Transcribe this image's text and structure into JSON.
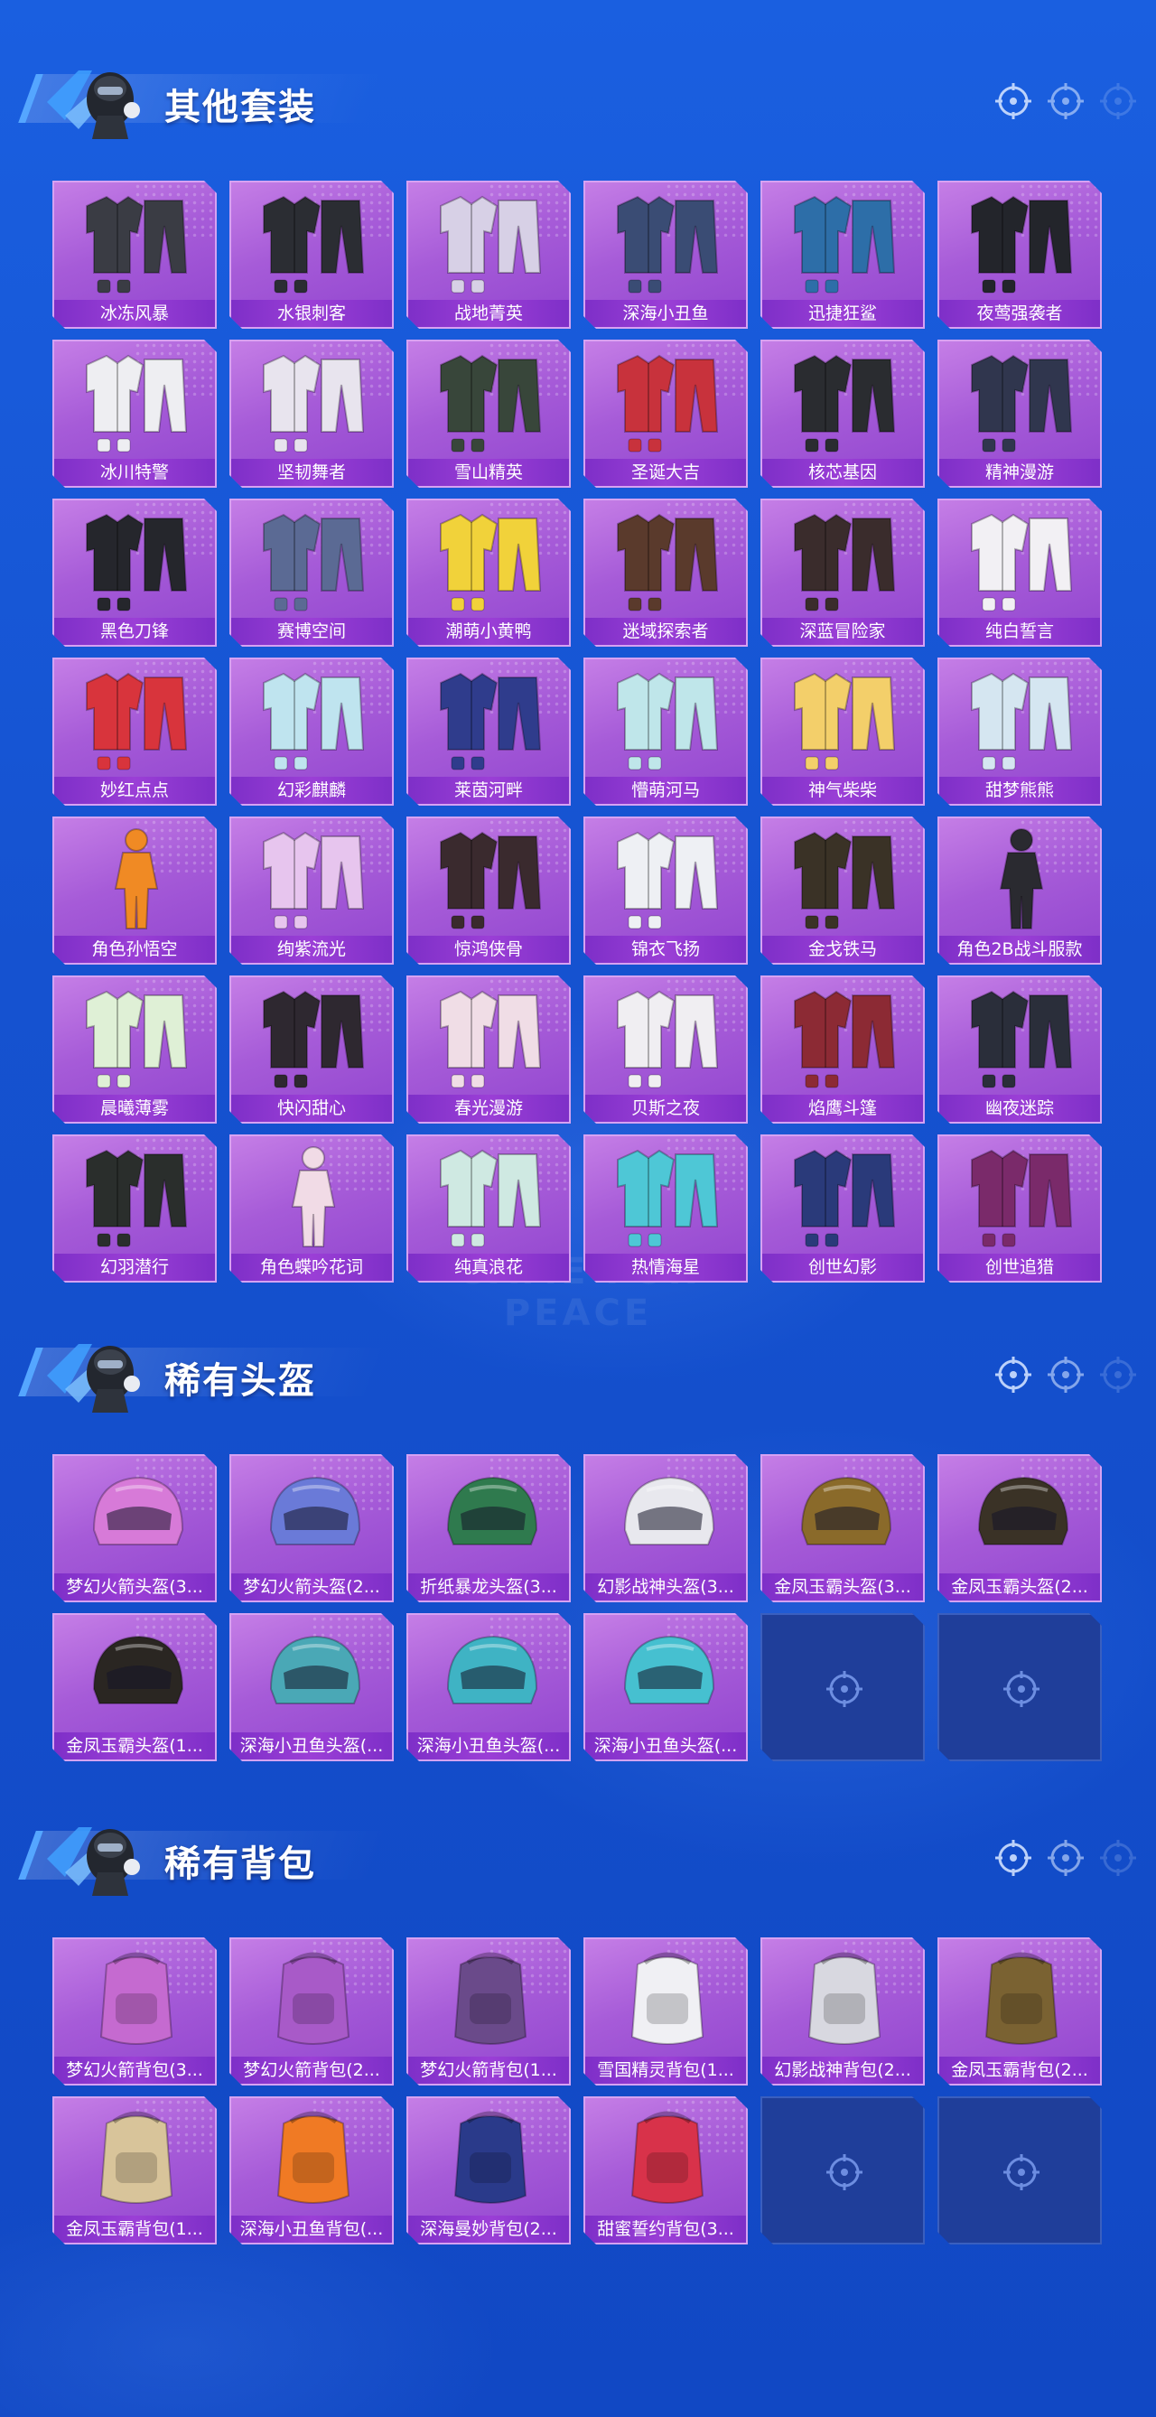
{
  "watermark": "GAME FOR PEACE",
  "colors": {
    "background": "#1552d0",
    "card_fill": "#a65bd8",
    "card_label": "#8a35cf",
    "empty_card": "#1f3e9a"
  },
  "sections": [
    {
      "title": "其他套装",
      "items": [
        {
          "label": "冰冻风暴",
          "icon": "hooded-jacket-outfit-icon",
          "tone": "#3a3c44"
        },
        {
          "label": "水银刺客",
          "icon": "leather-jacket-outfit-icon",
          "tone": "#2b2d33"
        },
        {
          "label": "战地菁英",
          "icon": "striped-sweater-outfit-icon",
          "tone": "#d7d0e6"
        },
        {
          "label": "深海小丑鱼",
          "icon": "colorful-jacket-outfit-icon",
          "tone": "#3a4c74"
        },
        {
          "label": "迅捷狂鲨",
          "icon": "shark-tshirt-outfit-icon",
          "tone": "#2d6ea8"
        },
        {
          "label": "夜莺强袭者",
          "icon": "black-jacket-outfit-icon",
          "tone": "#23252b"
        },
        {
          "label": "冰川特警",
          "icon": "white-suit-outfit-icon",
          "tone": "#eeeef2"
        },
        {
          "label": "坚韧舞者",
          "icon": "white-dress-outfit-icon",
          "tone": "#e8e4ee"
        },
        {
          "label": "雪山精英",
          "icon": "green-coat-outfit-icon",
          "tone": "#38463a"
        },
        {
          "label": "圣诞大吉",
          "icon": "santa-outfit-icon",
          "tone": "#c8323c"
        },
        {
          "label": "核芯基因",
          "icon": "armored-mask-outfit-icon",
          "tone": "#2a2c30"
        },
        {
          "label": "精神漫游",
          "icon": "cyber-suit-outfit-icon",
          "tone": "#30364e"
        },
        {
          "label": "黑色刀锋",
          "icon": "black-coat-outfit-icon",
          "tone": "#25262c"
        },
        {
          "label": "赛博空间",
          "icon": "cyber-dress-outfit-icon",
          "tone": "#5b6a94"
        },
        {
          "label": "潮萌小黄鸭",
          "icon": "yellow-duck-outfit-icon",
          "tone": "#f1d23a"
        },
        {
          "label": "迷域探索者",
          "icon": "explorer-coat-outfit-icon",
          "tone": "#5a3a2c"
        },
        {
          "label": "深蓝冒险家",
          "icon": "adventurer-coat-outfit-icon",
          "tone": "#3a2c2c"
        },
        {
          "label": "纯白誓言",
          "icon": "wedding-outfit-icon",
          "tone": "#f2f0f4"
        },
        {
          "label": "妙红点点",
          "icon": "red-dress-outfit-icon",
          "tone": "#d8343c"
        },
        {
          "label": "幻彩麒麟",
          "icon": "pastel-outfit-icon",
          "tone": "#bfe4ef"
        },
        {
          "label": "莱茵河畔",
          "icon": "navy-uniform-outfit-icon",
          "tone": "#2f3c8c"
        },
        {
          "label": "懵萌河马",
          "icon": "hippo-pajama-outfit-icon",
          "tone": "#bfe6ea"
        },
        {
          "label": "神气柴柴",
          "icon": "shiba-pajama-outfit-icon",
          "tone": "#f3cf6a"
        },
        {
          "label": "甜梦熊熊",
          "icon": "bear-pajama-outfit-icon",
          "tone": "#d5e6f1"
        },
        {
          "label": "角色孙悟空",
          "icon": "goku-character-icon",
          "tone": "#f08a24"
        },
        {
          "label": "绚紫流光",
          "icon": "lilac-outfit-icon",
          "tone": "#e7c5ee"
        },
        {
          "label": "惊鸿侠骨",
          "icon": "wuxia-robe-outfit-icon",
          "tone": "#3a2a2e"
        },
        {
          "label": "锦衣飞扬",
          "icon": "white-robe-outfit-icon",
          "tone": "#eef0f4"
        },
        {
          "label": "金戈铁马",
          "icon": "gold-armor-outfit-icon",
          "tone": "#3a3226"
        },
        {
          "label": "角色2B战斗服款",
          "icon": "2b-character-icon",
          "tone": "#2a2a30"
        },
        {
          "label": "晨曦薄雾",
          "icon": "mint-outfit-icon",
          "tone": "#dff0d6"
        },
        {
          "label": "快闪甜心",
          "icon": "heart-jacket-outfit-icon",
          "tone": "#2e2830"
        },
        {
          "label": "春光漫游",
          "icon": "pink-jacket-outfit-icon",
          "tone": "#f0dde6"
        },
        {
          "label": "贝斯之夜",
          "icon": "bass-night-outfit-icon",
          "tone": "#f0eef2"
        },
        {
          "label": "焰鹰斗篷",
          "icon": "red-cloak-outfit-icon",
          "tone": "#8c2a34"
        },
        {
          "label": "幽夜迷踪",
          "icon": "night-suit-outfit-icon",
          "tone": "#2a2e3a"
        },
        {
          "label": "幻羽潜行",
          "icon": "feather-suit-outfit-icon",
          "tone": "#2a2e2c"
        },
        {
          "label": "角色蝶吟花词",
          "icon": "butterfly-character-icon",
          "tone": "#f1dbe6"
        },
        {
          "label": "纯真浪花",
          "icon": "wave-outfit-icon",
          "tone": "#cfe9e2"
        },
        {
          "label": "热情海星",
          "icon": "starfish-outfit-icon",
          "tone": "#4ec7d6"
        },
        {
          "label": "创世幻影",
          "icon": "genesis-phantom-outfit-icon",
          "tone": "#2a3a7a"
        },
        {
          "label": "创世追猎",
          "icon": "genesis-hunter-outfit-icon",
          "tone": "#7a2a6a"
        }
      ]
    },
    {
      "title": "稀有头盔",
      "items": [
        {
          "label": "梦幻火箭头盔(3...",
          "icon": "pink-rocket-helmet-icon",
          "tone": "#d77ad8"
        },
        {
          "label": "梦幻火箭头盔(2...",
          "icon": "blue-rocket-helmet-icon",
          "tone": "#6a7ad8"
        },
        {
          "label": "折纸暴龙头盔(3...",
          "icon": "dino-helmet-icon",
          "tone": "#2f7a4e"
        },
        {
          "label": "幻影战神头盔(3...",
          "icon": "phantom-helmet-icon",
          "tone": "#e8e8ee"
        },
        {
          "label": "金凤玉霸头盔(3...",
          "icon": "gold-phoenix-helmet-icon",
          "tone": "#8a6a2a"
        },
        {
          "label": "金凤玉霸头盔(2...",
          "icon": "dark-phoenix-helmet-icon",
          "tone": "#3a3226"
        },
        {
          "label": "金凤玉霸头盔(1...",
          "icon": "black-phoenix-helmet-icon",
          "tone": "#2a2622"
        },
        {
          "label": "深海小丑鱼头盔(...",
          "icon": "clownfish-helmet-icon",
          "tone": "#4aa8b6"
        },
        {
          "label": "深海小丑鱼头盔(...",
          "icon": "clownfish-helmet-icon",
          "tone": "#3fb3c4"
        },
        {
          "label": "深海小丑鱼头盔(...",
          "icon": "clownfish-helmet-icon",
          "tone": "#46c0d0"
        },
        {
          "empty": true
        },
        {
          "empty": true
        }
      ]
    },
    {
      "title": "稀有背包",
      "items": [
        {
          "label": "梦幻火箭背包(3...",
          "icon": "pink-rocket-backpack-icon",
          "tone": "#c56ad0"
        },
        {
          "label": "梦幻火箭背包(2...",
          "icon": "purple-rocket-backpack-icon",
          "tone": "#a85ac8"
        },
        {
          "label": "梦幻火箭背包(1...",
          "icon": "dark-rocket-backpack-icon",
          "tone": "#6a4a8a"
        },
        {
          "label": "雪国精灵背包(1...",
          "icon": "snow-sprite-backpack-icon",
          "tone": "#f0f0f4"
        },
        {
          "label": "幻影战神背包(2...",
          "icon": "phantom-backpack-icon",
          "tone": "#d8d8e0"
        },
        {
          "label": "金凤玉霸背包(2...",
          "icon": "gold-phoenix-backpack-icon",
          "tone": "#7a6232"
        },
        {
          "label": "金凤玉霸背包(1...",
          "icon": "cream-phoenix-backpack-icon",
          "tone": "#d8c49a"
        },
        {
          "label": "深海小丑鱼背包(...",
          "icon": "clownfish-backpack-icon",
          "tone": "#f07a24"
        },
        {
          "label": "深海曼妙背包(2...",
          "icon": "deep-sea-backpack-icon",
          "tone": "#2a3a8a"
        },
        {
          "label": "甜蜜誓约背包(3...",
          "icon": "heart-backpack-icon",
          "tone": "#d8324a"
        },
        {
          "empty": true
        },
        {
          "empty": true
        }
      ]
    }
  ]
}
